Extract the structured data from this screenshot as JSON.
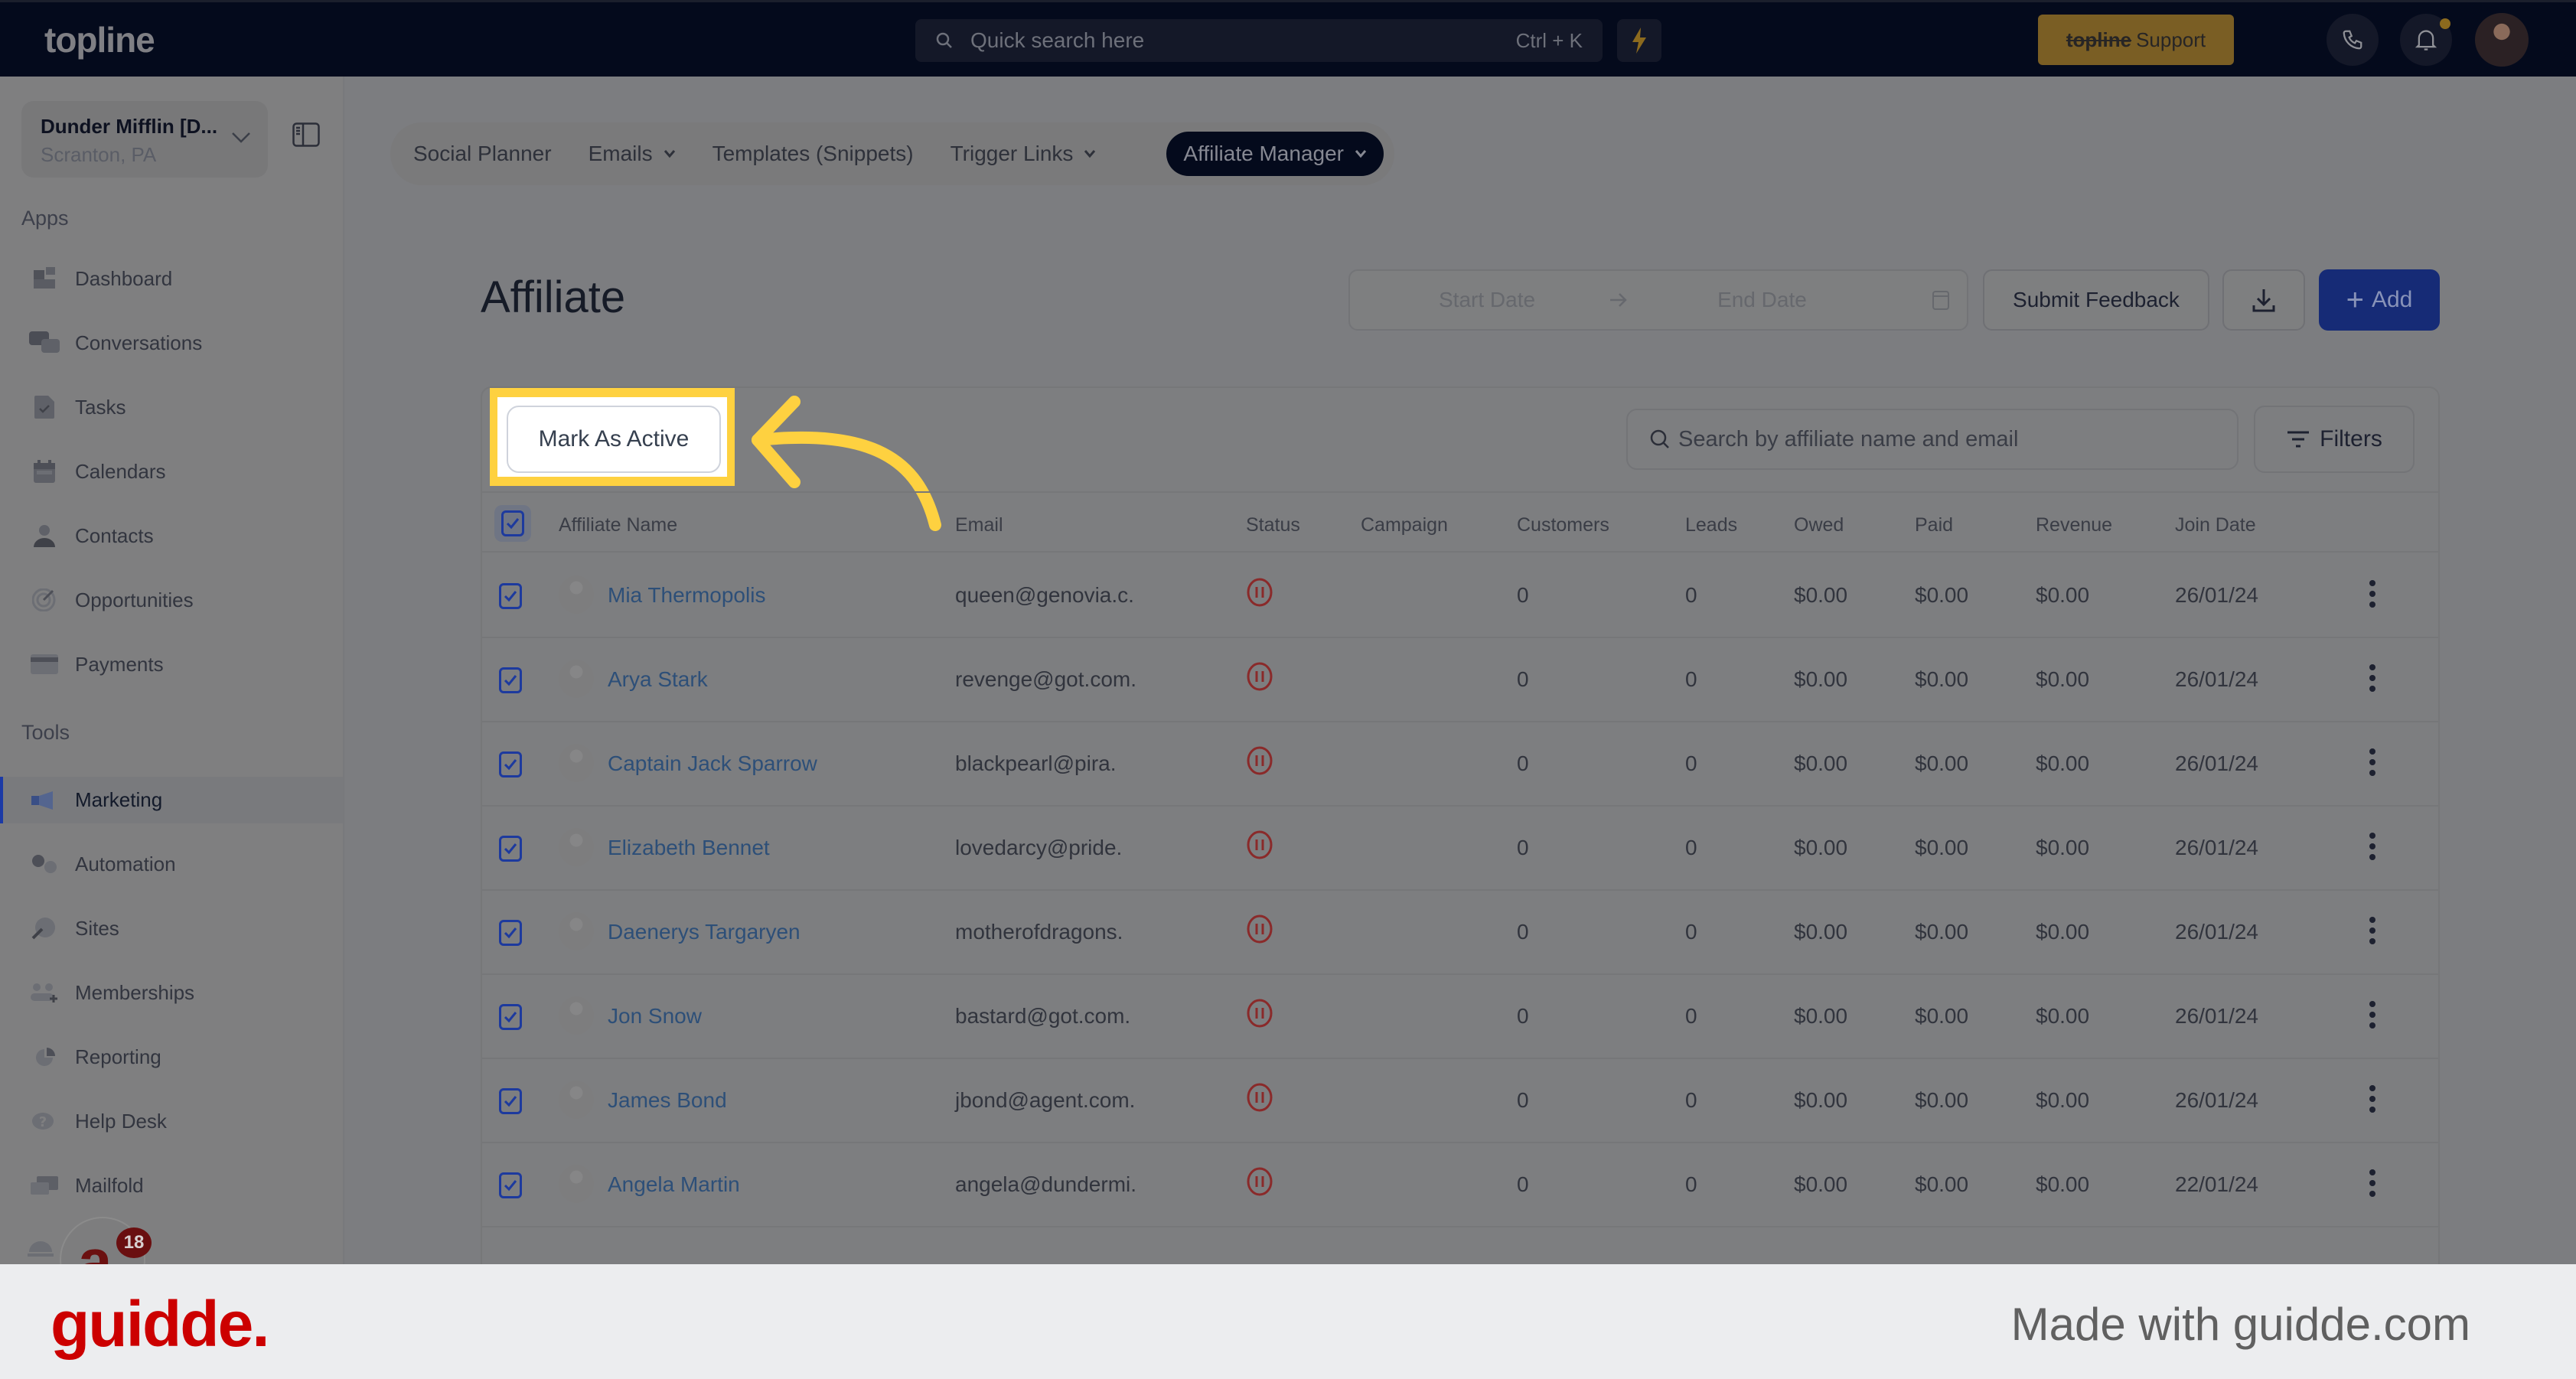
{
  "topbar": {
    "logo": "topline",
    "search_placeholder": "Quick search here",
    "search_shortcut": "Ctrl + K",
    "support_brand": "topline",
    "support_label": "Support",
    "colors": {
      "bar_bg": "#040a1c",
      "bolt": "#8c6a1e",
      "support_bg": "#7a5e24"
    }
  },
  "sidebar": {
    "location_name": "Dunder Mifflin [D...",
    "location_sub": "Scranton, PA",
    "apps_label": "Apps",
    "apps": [
      {
        "label": "Dashboard",
        "icon": "dashboard-icon"
      },
      {
        "label": "Conversations",
        "icon": "chat-bubbles-icon"
      },
      {
        "label": "Tasks",
        "icon": "task-file-icon"
      },
      {
        "label": "Calendars",
        "icon": "calendar-icon"
      },
      {
        "label": "Contacts",
        "icon": "person-icon"
      },
      {
        "label": "Opportunities",
        "icon": "target-icon"
      },
      {
        "label": "Payments",
        "icon": "credit-card-icon"
      }
    ],
    "tools_label": "Tools",
    "tools": [
      {
        "label": "Marketing",
        "icon": "megaphone-icon",
        "active": true
      },
      {
        "label": "Automation",
        "icon": "gears-icon"
      },
      {
        "label": "Sites",
        "icon": "globe-cursor-icon"
      },
      {
        "label": "Memberships",
        "icon": "users-plus-icon"
      },
      {
        "label": "Reporting",
        "icon": "pie-chart-icon"
      },
      {
        "label": "Help Desk",
        "icon": "question-icon"
      },
      {
        "label": "Mailfold",
        "icon": "mail-icon"
      }
    ],
    "fab_letter": "a",
    "fab_badge": "18",
    "accent": "#1c3aa6"
  },
  "subnav": {
    "tabs": [
      {
        "label": "Social Planner",
        "dropdown": false
      },
      {
        "label": "Emails",
        "dropdown": true
      },
      {
        "label": "Templates (Snippets)",
        "dropdown": false
      },
      {
        "label": "Trigger Links",
        "dropdown": true
      },
      {
        "label": "Affiliate Manager",
        "dropdown": true,
        "active": true
      }
    ]
  },
  "header": {
    "title": "Affiliate",
    "start_date_placeholder": "Start Date",
    "end_date_placeholder": "End Date",
    "submit_feedback": "Submit Feedback",
    "add_label": "Add"
  },
  "table": {
    "bulk_action": "Mark As Active",
    "search_placeholder": "Search by affiliate name and email",
    "filters_label": "Filters",
    "columns": [
      "Affiliate Name",
      "Email",
      "Status",
      "Campaign",
      "Customers",
      "Leads",
      "Owed",
      "Paid",
      "Revenue",
      "Join Date"
    ],
    "rows": [
      {
        "name": "Mia Thermopolis",
        "email": "queen@genovia.c.",
        "status": "paused",
        "campaign": "",
        "customers": "0",
        "leads": "0",
        "owed": "$0.00",
        "paid": "$0.00",
        "revenue": "$0.00",
        "join_date": "26/01/24",
        "checked": true
      },
      {
        "name": "Arya Stark",
        "email": "revenge@got.com.",
        "status": "paused",
        "campaign": "",
        "customers": "0",
        "leads": "0",
        "owed": "$0.00",
        "paid": "$0.00",
        "revenue": "$0.00",
        "join_date": "26/01/24",
        "checked": true
      },
      {
        "name": "Captain Jack Sparrow",
        "email": "blackpearl@pira.",
        "status": "paused",
        "campaign": "",
        "customers": "0",
        "leads": "0",
        "owed": "$0.00",
        "paid": "$0.00",
        "revenue": "$0.00",
        "join_date": "26/01/24",
        "checked": true
      },
      {
        "name": "Elizabeth Bennet",
        "email": "lovedarcy@pride.",
        "status": "paused",
        "campaign": "",
        "customers": "0",
        "leads": "0",
        "owed": "$0.00",
        "paid": "$0.00",
        "revenue": "$0.00",
        "join_date": "26/01/24",
        "checked": true
      },
      {
        "name": "Daenerys Targaryen",
        "email": "motherofdragons.",
        "status": "paused",
        "campaign": "",
        "customers": "0",
        "leads": "0",
        "owed": "$0.00",
        "paid": "$0.00",
        "revenue": "$0.00",
        "join_date": "26/01/24",
        "checked": true
      },
      {
        "name": "Jon Snow",
        "email": "bastard@got.com.",
        "status": "paused",
        "campaign": "",
        "customers": "0",
        "leads": "0",
        "owed": "$0.00",
        "paid": "$0.00",
        "revenue": "$0.00",
        "join_date": "26/01/24",
        "checked": true
      },
      {
        "name": "James Bond",
        "email": "jbond@agent.com.",
        "status": "paused",
        "campaign": "",
        "customers": "0",
        "leads": "0",
        "owed": "$0.00",
        "paid": "$0.00",
        "revenue": "$0.00",
        "join_date": "26/01/24",
        "checked": true
      },
      {
        "name": "Angela Martin",
        "email": "angela@dundermi.",
        "status": "paused",
        "campaign": "",
        "customers": "0",
        "leads": "0",
        "owed": "$0.00",
        "paid": "$0.00",
        "revenue": "$0.00",
        "join_date": "22/01/24",
        "checked": true
      }
    ],
    "colors": {
      "link": "#2d4f78",
      "status_paused": "#8a2a2a",
      "check": "#1d3a9e"
    }
  },
  "annotation": {
    "highlight_color": "#fed140"
  },
  "footer": {
    "brand": "guidde.",
    "tagline": "Made with guidde.com",
    "brand_color": "#cc0000"
  }
}
